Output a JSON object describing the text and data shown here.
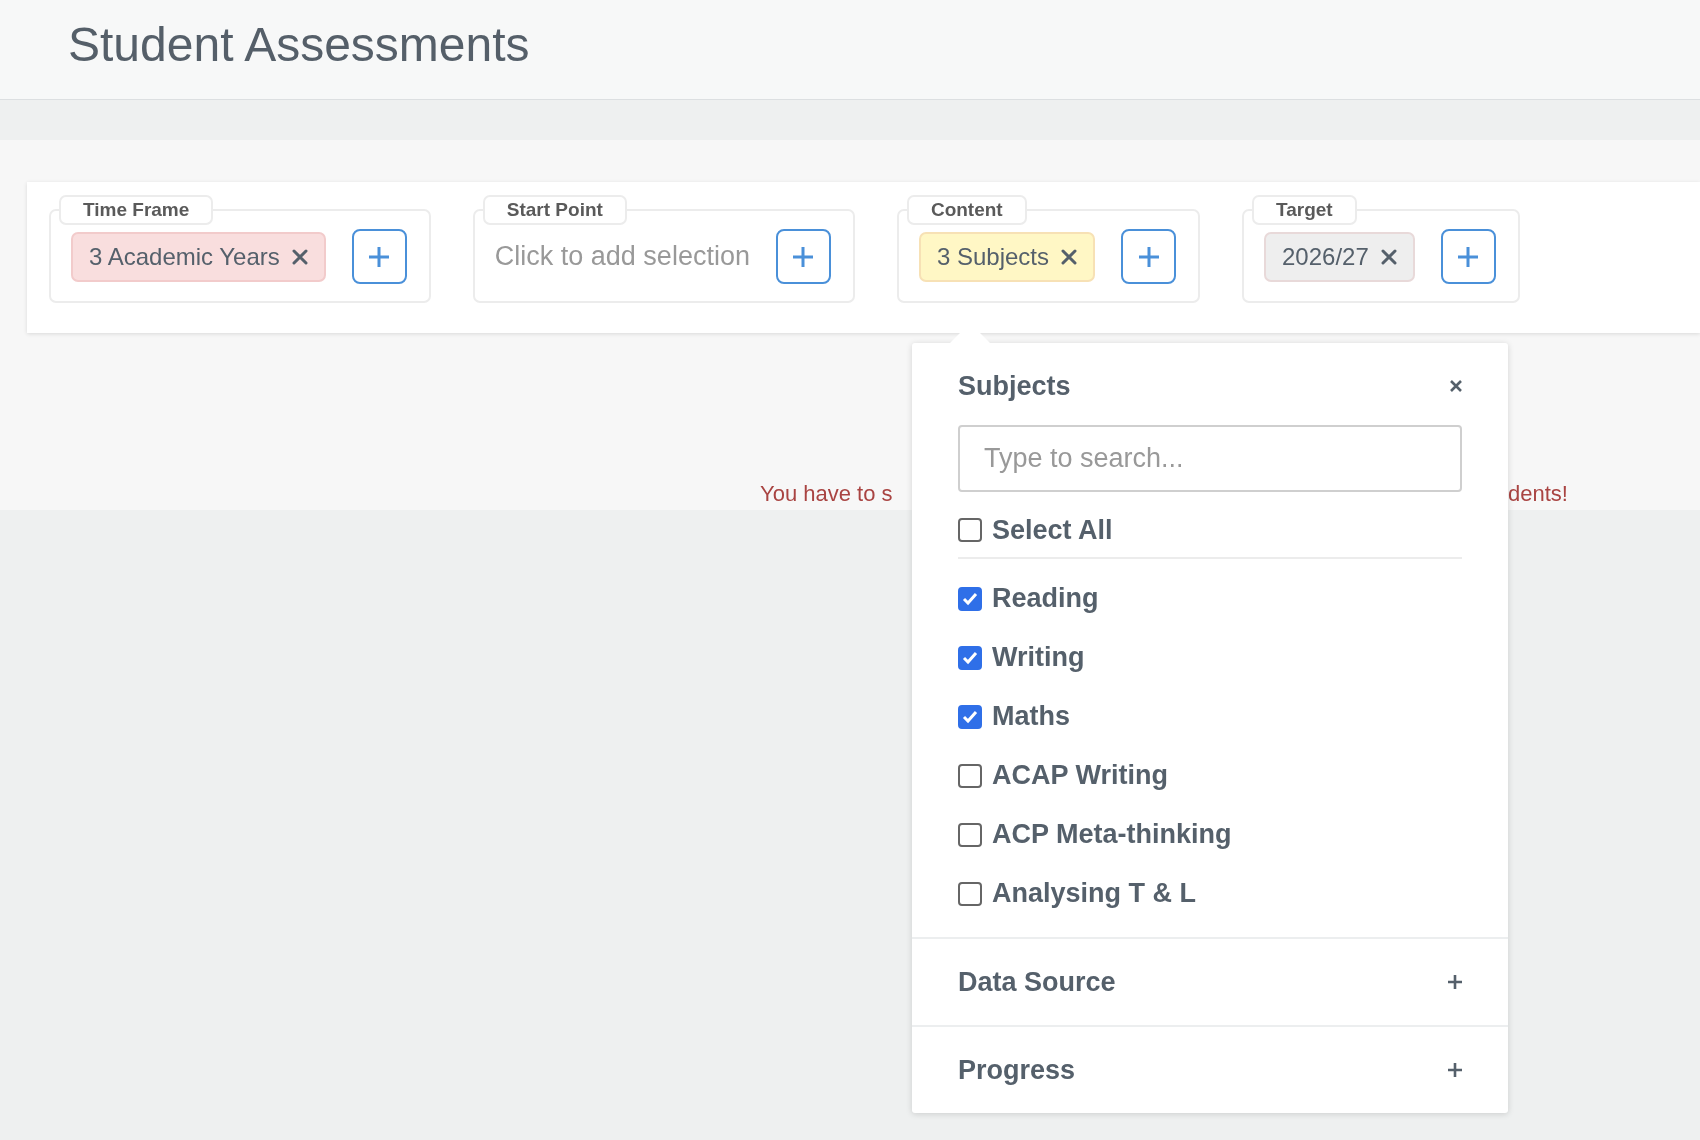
{
  "title": "Student Assessments",
  "filters": [
    {
      "label": "Time Frame",
      "chip": {
        "text": "3 Academic Years",
        "color": "#f9dede"
      }
    },
    {
      "label": "Start Point",
      "placeholder": "Click to add selection"
    },
    {
      "label": "Content",
      "chip": {
        "text": "3 Subjects",
        "color": "#fff7c5"
      }
    },
    {
      "label": "Target",
      "chip": {
        "text": "2026/27",
        "color": "#eeeeee"
      }
    }
  ],
  "error_parts": [
    "You have to s",
    "dents!"
  ],
  "popup": {
    "title": "Subjects",
    "search": {
      "placeholder": "Type to search..."
    },
    "select_all": {
      "label": "Select All",
      "checked": false
    },
    "items": [
      {
        "label": "Reading",
        "checked": true
      },
      {
        "label": "Writing",
        "checked": true
      },
      {
        "label": "Maths",
        "checked": true
      },
      {
        "label": "ACAP Writing",
        "checked": false
      },
      {
        "label": "ACP Meta-thinking",
        "checked": false
      },
      {
        "label": "Analysing T & L",
        "checked": false
      }
    ],
    "sections": [
      {
        "label": "Data Source",
        "expanded": false
      },
      {
        "label": "Progress",
        "expanded": false
      }
    ]
  }
}
